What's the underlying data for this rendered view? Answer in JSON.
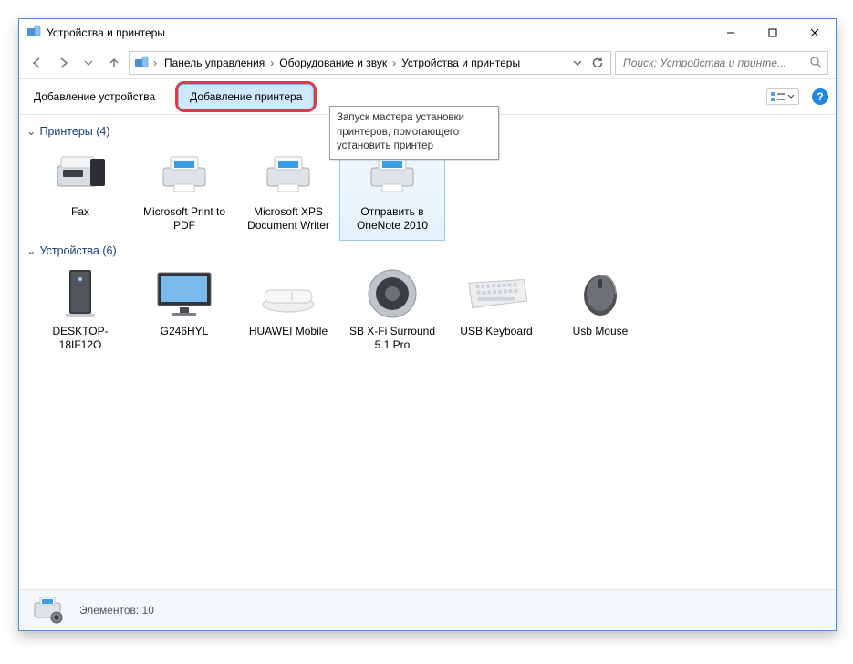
{
  "window": {
    "title": "Устройства и принтеры"
  },
  "breadcrumbs": {
    "c0": "Панель управления",
    "c1": "Оборудование и звук",
    "c2": "Устройства и принтеры"
  },
  "search": {
    "placeholder": "Поиск: Устройства и принте..."
  },
  "toolbar": {
    "add_device": "Добавление устройства",
    "add_printer": "Добавление принтера",
    "help_glyph": "?"
  },
  "tooltip": {
    "text": "Запуск мастера установки принтеров, помогающего установить принтер"
  },
  "group_printers": {
    "title": "Принтеры (4)",
    "items": {
      "i0": "Fax",
      "i1": "Microsoft Print to PDF",
      "i2": "Microsoft XPS Document Writer",
      "i3": "Отправить в OneNote 2010"
    }
  },
  "group_devices": {
    "title": "Устройства (6)",
    "items": {
      "i0": "DESKTOP-18IF12O",
      "i1": "G246HYL",
      "i2": "HUAWEI Mobile",
      "i3": "SB X-Fi Surround 5.1 Pro",
      "i4": "USB Keyboard",
      "i5": "Usb Mouse"
    }
  },
  "statusbar": {
    "label": "Элементов: 10"
  }
}
